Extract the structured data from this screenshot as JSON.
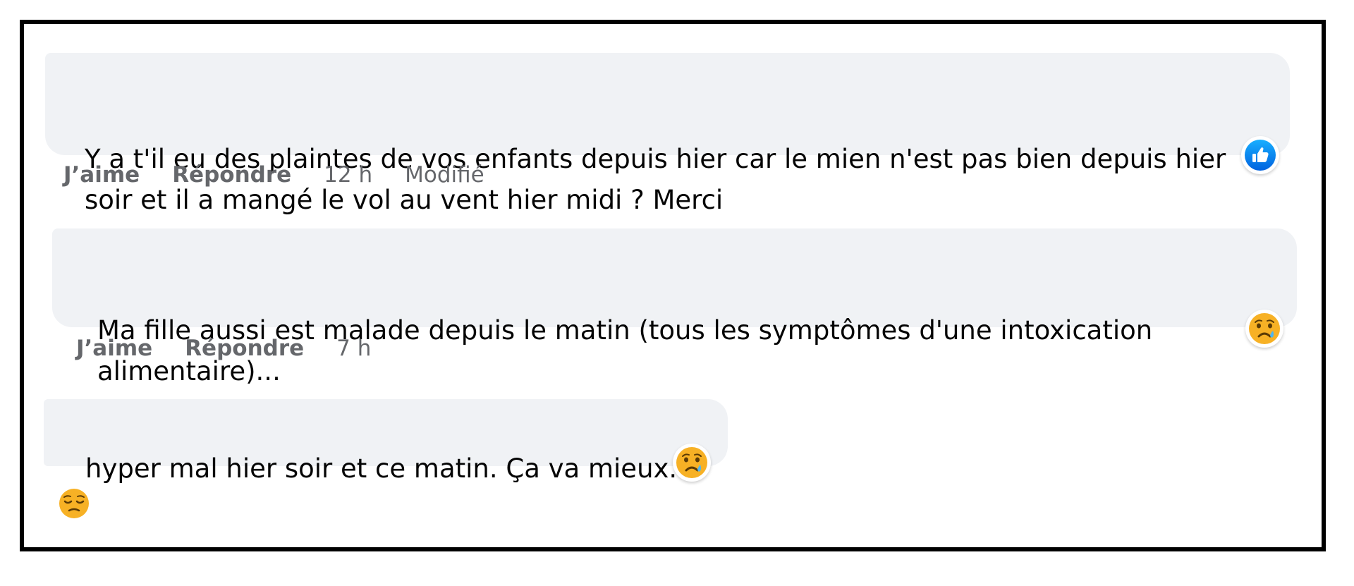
{
  "comments": [
    {
      "text": "Y a t'il eu des plaintes de vos enfants depuis hier car le mien n'est pas bien depuis hier\nsoir et il a mangé le vol au vent hier midi ? Merci",
      "like_label": "J’aime",
      "reply_label": "Répondre",
      "time": "12 h",
      "edited_label": "Modifié",
      "reaction_icon": "like-icon",
      "reaction_color": "#1877f2"
    },
    {
      "text": "Ma fille aussi est malade depuis le matin (tous les symptômes d'une intoxication\nalimentaire)...",
      "like_label": "J’aime",
      "reply_label": "Répondre",
      "time": "7 h",
      "reaction_icon": "sad-icon"
    },
    {
      "text": "hyper mal hier soir et ce matin. Ça va mieux.",
      "inline_emoji": "relieved-face-icon",
      "reaction_icon": "sad-icon"
    }
  ],
  "colors": {
    "bubble_bg": "#f0f2f5",
    "text": "#050505",
    "meta_text": "#65676b",
    "frame_border": "#000000",
    "emoji_yellow": "#f7b125"
  }
}
